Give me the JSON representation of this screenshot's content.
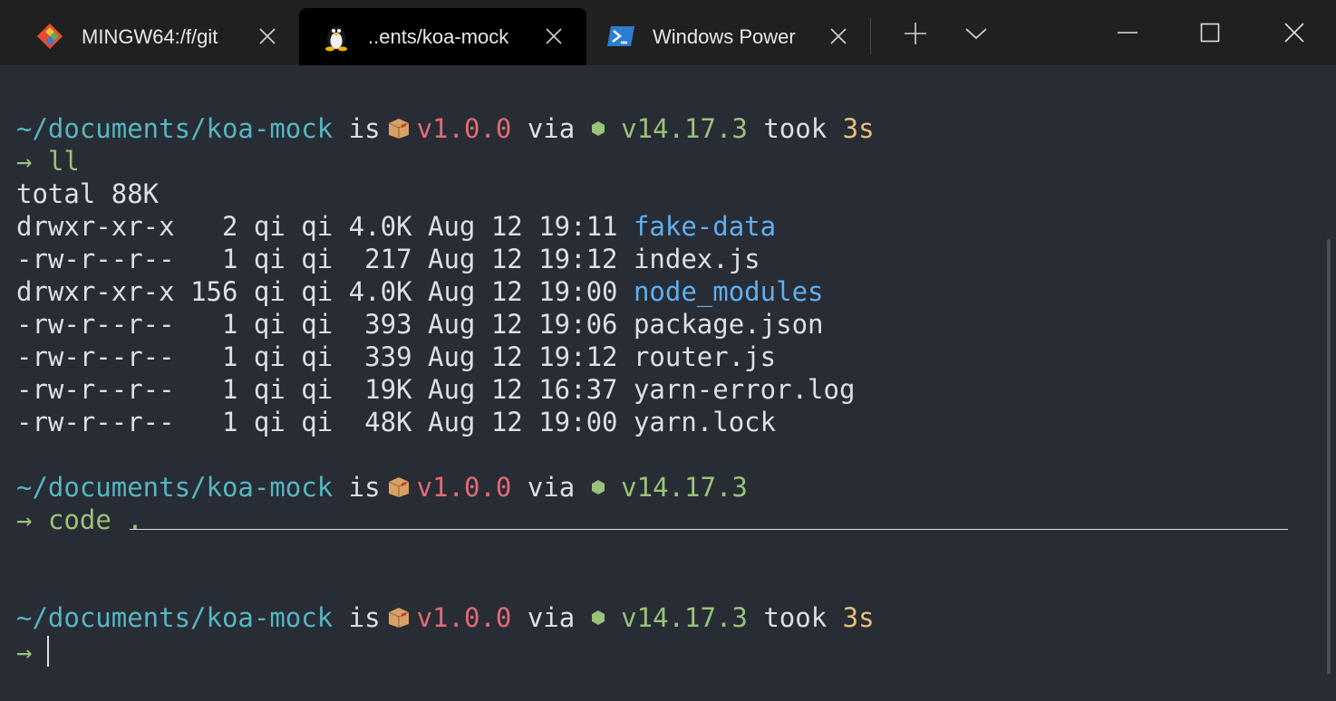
{
  "tabs": [
    {
      "label": "MINGW64:/f/git",
      "icon": "git-bash-icon",
      "active": false
    },
    {
      "label": "..ents/koa-mock",
      "icon": "linux-penguin-icon",
      "active": true
    },
    {
      "label": "Windows Power",
      "icon": "powershell-icon",
      "active": false
    }
  ],
  "prompt": {
    "path": "~/documents/koa-mock",
    "is": "is",
    "version": "v1.0.0",
    "via": "via",
    "node_version": "v14.17.3",
    "took": "took",
    "duration": "3s",
    "arrow": "→"
  },
  "commands": [
    "ll",
    "code ."
  ],
  "ls_output": {
    "total": "total 88K",
    "entries": [
      {
        "perms": "drwxr-xr-x",
        "links": "  2",
        "meta": " qi qi 4.0K Aug 12 19:11 ",
        "name": "fake-data",
        "is_dir": true
      },
      {
        "perms": "-rw-r--r--",
        "links": "  1",
        "meta": " qi qi  217 Aug 12 19:12 ",
        "name": "index.js",
        "is_dir": false
      },
      {
        "perms": "drwxr-xr-x",
        "links": "156",
        "meta": " qi qi 4.0K Aug 12 19:00 ",
        "name": "node_modules",
        "is_dir": true
      },
      {
        "perms": "-rw-r--r--",
        "links": "  1",
        "meta": " qi qi  393 Aug 12 19:06 ",
        "name": "package.json",
        "is_dir": false
      },
      {
        "perms": "-rw-r--r--",
        "links": "  1",
        "meta": " qi qi  339 Aug 12 19:12 ",
        "name": "router.js",
        "is_dir": false
      },
      {
        "perms": "-rw-r--r--",
        "links": "  1",
        "meta": " qi qi  19K Aug 12 16:37 ",
        "name": "yarn-error.log",
        "is_dir": false
      },
      {
        "perms": "-rw-r--r--",
        "links": "  1",
        "meta": " qi qi  48K Aug 12 19:00 ",
        "name": "yarn.lock",
        "is_dir": false
      }
    ]
  },
  "colors": {
    "background": "#282c34",
    "path": "#56b6c2",
    "version": "#e06c75",
    "node": "#98c379",
    "duration": "#e5c07b",
    "directory": "#61afef",
    "text": "#dcdfe4"
  },
  "icons": {
    "package": "package-box-icon",
    "node": "node-hexagon-icon",
    "new_tab": "plus-icon",
    "dropdown": "chevron-down-icon",
    "minimize": "minimize-icon",
    "maximize": "maximize-icon",
    "close": "close-icon"
  }
}
